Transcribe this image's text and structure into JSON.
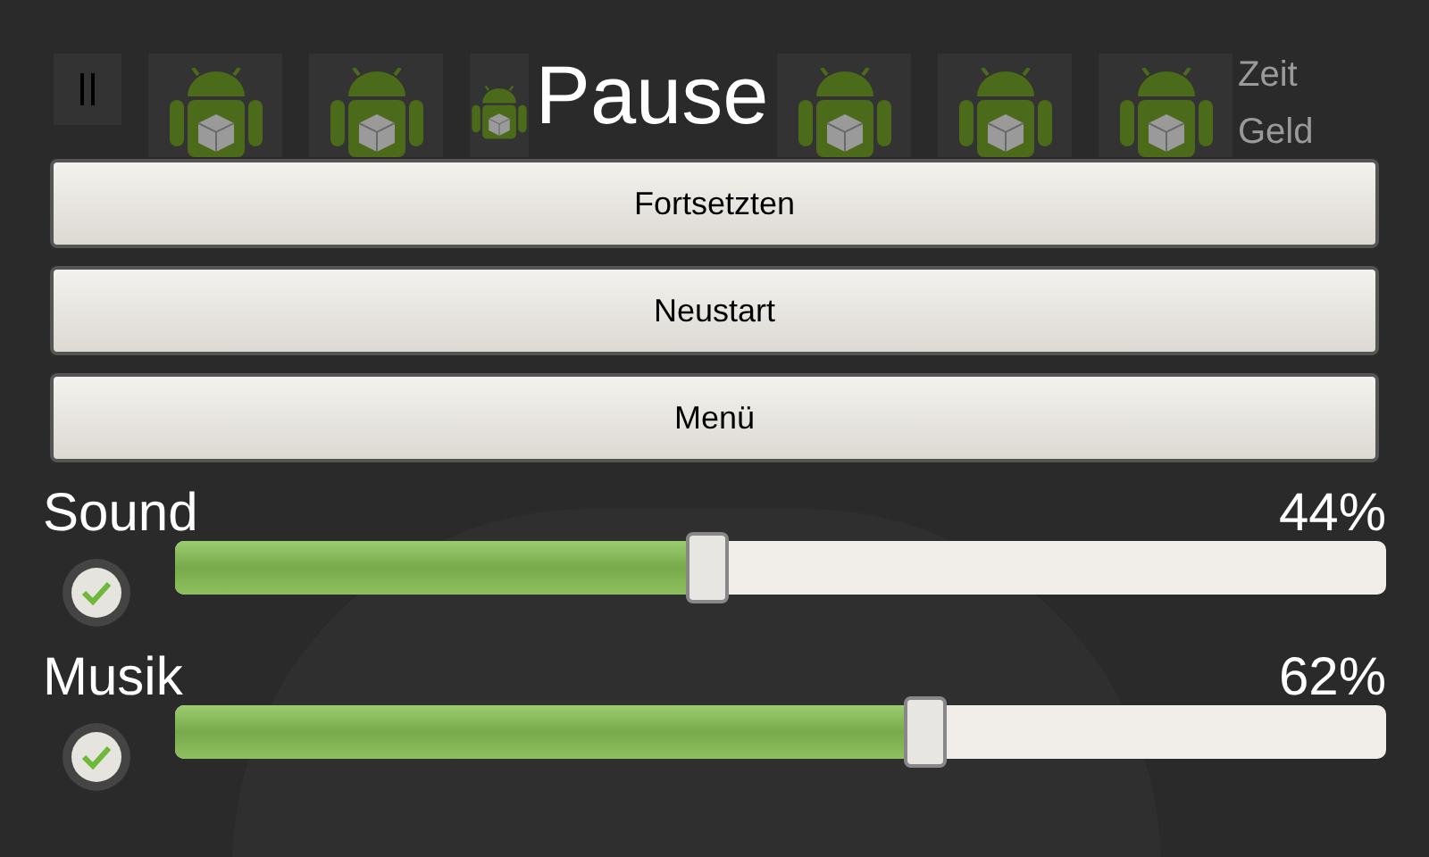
{
  "game_bar": {
    "stats": [
      "Zeit",
      "Geld"
    ]
  },
  "dialog": {
    "title": "Pause",
    "buttons": [
      "Fortsetzten",
      "Neustart",
      "Menü"
    ],
    "sliders": [
      {
        "label": "Sound",
        "reading": "44%",
        "level": 0.44,
        "checked": true
      },
      {
        "label": "Musik",
        "reading": "62%",
        "level": 0.62,
        "checked": true
      }
    ]
  }
}
